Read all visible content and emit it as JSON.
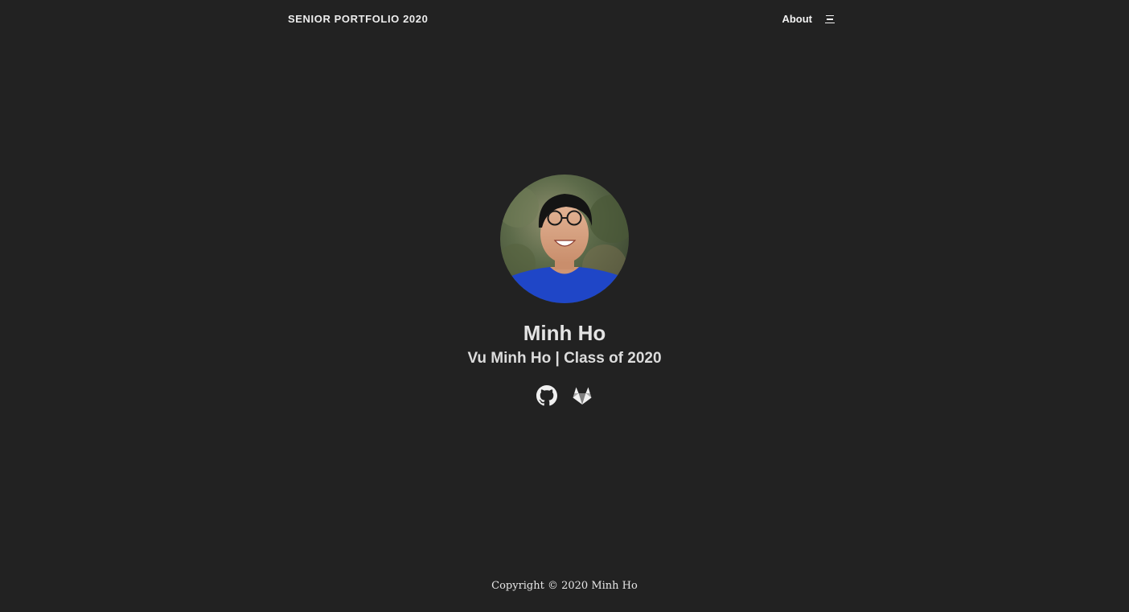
{
  "header": {
    "site_title": "SENIOR PORTFOLIO 2020",
    "nav_about": "About",
    "menu_icon": "hamburger-menu-icon"
  },
  "profile": {
    "avatar_alt": "Minh Ho",
    "name": "Minh Ho",
    "tagline": "Vu Minh Ho | Class of 2020"
  },
  "social": {
    "icons": [
      "github-icon",
      "gitlab-icon"
    ]
  },
  "footer": {
    "copyright": "Copyright © 2020 Minh Ho"
  },
  "colors": {
    "background": "#222222",
    "text": "#e6e6e6",
    "shirt": "#1f46c7"
  }
}
